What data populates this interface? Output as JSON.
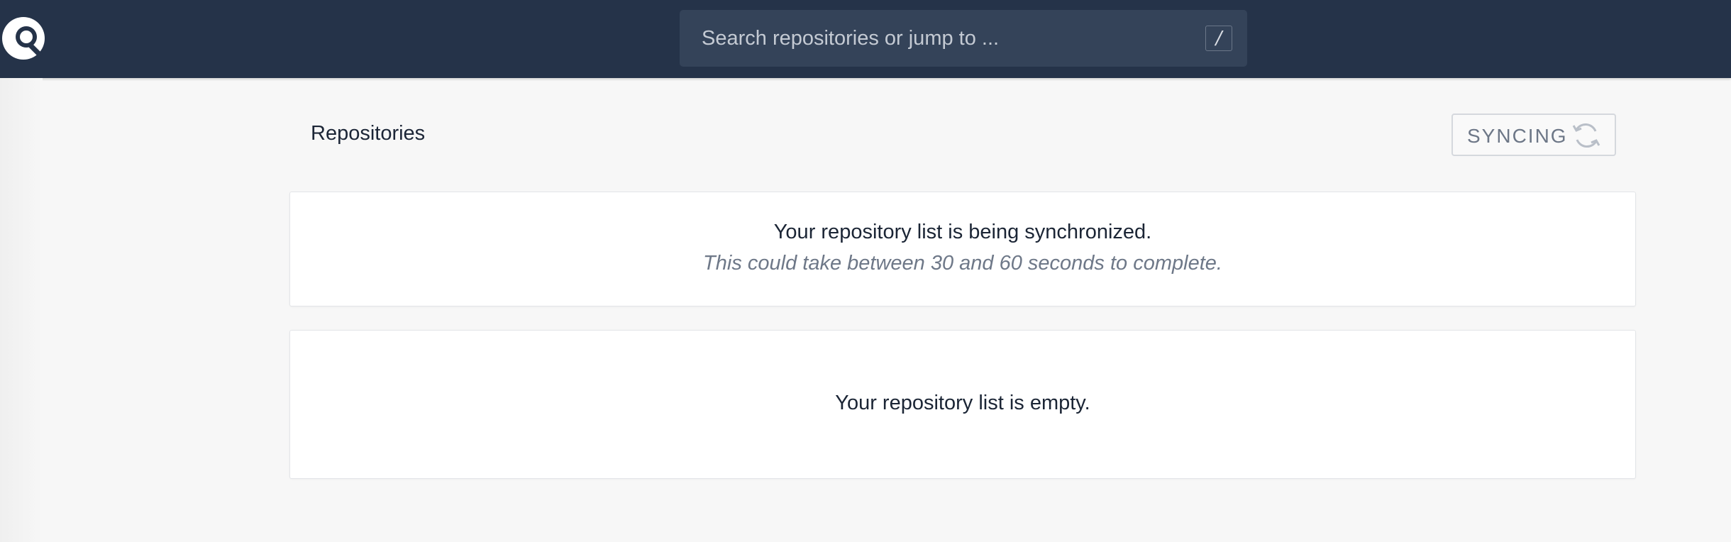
{
  "header": {
    "logo_icon": "search-logo-icon",
    "search": {
      "placeholder": "Search repositories or jump to ...",
      "value": "",
      "shortcut_key": "/"
    }
  },
  "main": {
    "title": "Repositories",
    "sync_button": {
      "label": "SYNCING",
      "icon": "sync-icon"
    },
    "sync_notice": {
      "message": "Your repository list is being synchronized.",
      "detail": "This could take between 30 and 60 seconds to complete."
    },
    "empty_state": {
      "message": "Your repository list is empty."
    }
  },
  "colors": {
    "header_bg": "#253349",
    "search_bg": "#344359",
    "page_bg": "#f7f7f7",
    "text_dark": "#1b2535",
    "text_muted": "#6e7888"
  }
}
